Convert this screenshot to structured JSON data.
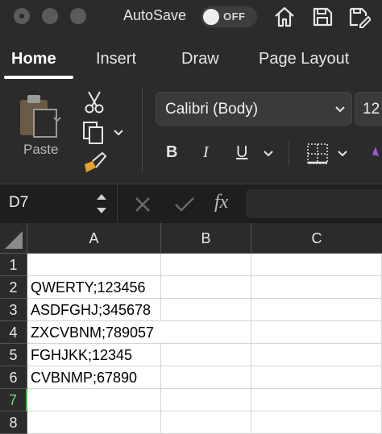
{
  "titlebar": {
    "autosave_label": "AutoSave",
    "toggle_state": "OFF"
  },
  "ribbon_tabs": [
    "Home",
    "Insert",
    "Draw",
    "Page Layout"
  ],
  "ribbon": {
    "paste_label": "Paste",
    "font_name": "Calibri (Body)",
    "font_size": "12",
    "bold": "B",
    "italic": "I",
    "underline": "U"
  },
  "formula_bar": {
    "cell_ref": "D7",
    "fx_label": "fx",
    "value": ""
  },
  "sheet": {
    "columns": [
      "A",
      "B",
      "C"
    ],
    "rows": [
      "1",
      "2",
      "3",
      "4",
      "5",
      "6",
      "7",
      "8"
    ],
    "col_a_values": [
      "",
      "QWERTY;123456",
      "ASDFGHJ;345678",
      "ZXCVBNM;789057",
      "FGHJKK;12345",
      "CVBNMP;67890",
      "",
      ""
    ],
    "selected_row": "7"
  },
  "colors": {
    "chrome": "#2b2b2b",
    "background": "#1e1e1e",
    "selection": "#4caf50"
  }
}
